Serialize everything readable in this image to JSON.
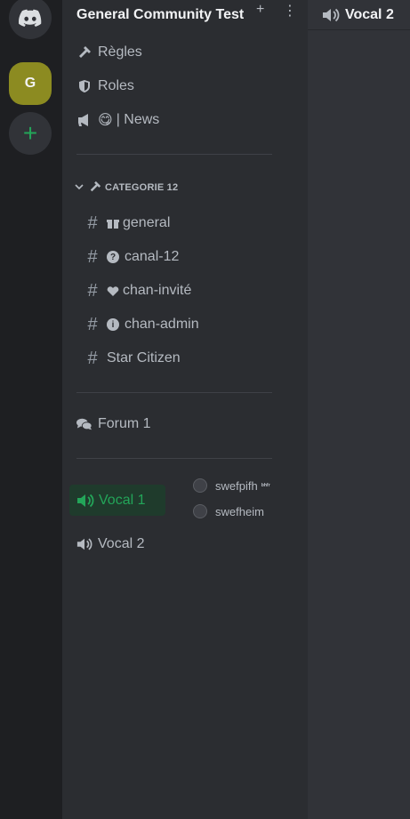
{
  "server": {
    "initial": "G",
    "add_symbol": "+",
    "name": "General Community Test"
  },
  "colors": {
    "server_accent": "#8c8b21",
    "voice_active": "#23a559"
  },
  "channels_top": [
    {
      "icon": "hammer-icon",
      "label": "Règles"
    },
    {
      "icon": "shield-icon",
      "label": "Roles"
    },
    {
      "icon": "megaphone-icon",
      "emoji": "😋",
      "label": "| News"
    }
  ],
  "category": {
    "label": "CATEGORIE 12"
  },
  "category_channels": [
    {
      "sub_icon": "gift-icon",
      "label": "general"
    },
    {
      "sub_icon": "question-icon",
      "sub_glyph": "?",
      "label": "canal-12"
    },
    {
      "sub_icon": "heart-icon",
      "label": "chan-invité"
    },
    {
      "sub_icon": "info-icon",
      "sub_glyph": "i",
      "label": "chan-admin"
    },
    {
      "label": "Star Citizen"
    }
  ],
  "forum": {
    "label": "Forum 1"
  },
  "voice_channels": [
    {
      "label": "Vocal 1",
      "active": true
    },
    {
      "label": "Vocal 2",
      "active": false
    }
  ],
  "voice_users": [
    {
      "name": "swefpifh",
      "tag": "ᵇʰᶠʳ"
    },
    {
      "name": "swefheim",
      "tag": ""
    }
  ],
  "topbar": {
    "title": "Vocal 2"
  }
}
